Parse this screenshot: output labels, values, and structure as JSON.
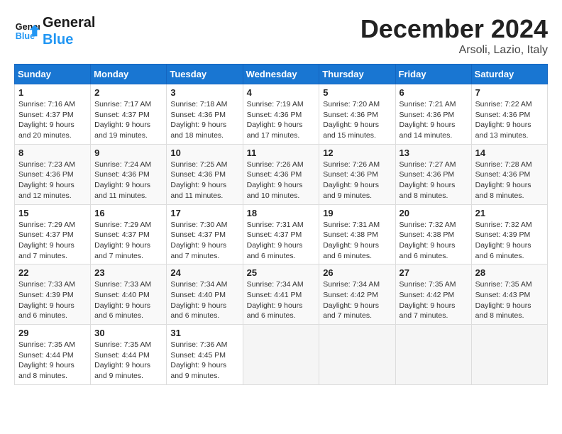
{
  "logo": {
    "line1": "General",
    "line2": "Blue"
  },
  "title": "December 2024",
  "location": "Arsoli, Lazio, Italy",
  "days_of_week": [
    "Sunday",
    "Monday",
    "Tuesday",
    "Wednesday",
    "Thursday",
    "Friday",
    "Saturday"
  ],
  "weeks": [
    [
      {
        "day": "1",
        "info": "Sunrise: 7:16 AM\nSunset: 4:37 PM\nDaylight: 9 hours and 20 minutes."
      },
      {
        "day": "2",
        "info": "Sunrise: 7:17 AM\nSunset: 4:37 PM\nDaylight: 9 hours and 19 minutes."
      },
      {
        "day": "3",
        "info": "Sunrise: 7:18 AM\nSunset: 4:36 PM\nDaylight: 9 hours and 18 minutes."
      },
      {
        "day": "4",
        "info": "Sunrise: 7:19 AM\nSunset: 4:36 PM\nDaylight: 9 hours and 17 minutes."
      },
      {
        "day": "5",
        "info": "Sunrise: 7:20 AM\nSunset: 4:36 PM\nDaylight: 9 hours and 15 minutes."
      },
      {
        "day": "6",
        "info": "Sunrise: 7:21 AM\nSunset: 4:36 PM\nDaylight: 9 hours and 14 minutes."
      },
      {
        "day": "7",
        "info": "Sunrise: 7:22 AM\nSunset: 4:36 PM\nDaylight: 9 hours and 13 minutes."
      }
    ],
    [
      {
        "day": "8",
        "info": "Sunrise: 7:23 AM\nSunset: 4:36 PM\nDaylight: 9 hours and 12 minutes."
      },
      {
        "day": "9",
        "info": "Sunrise: 7:24 AM\nSunset: 4:36 PM\nDaylight: 9 hours and 11 minutes."
      },
      {
        "day": "10",
        "info": "Sunrise: 7:25 AM\nSunset: 4:36 PM\nDaylight: 9 hours and 11 minutes."
      },
      {
        "day": "11",
        "info": "Sunrise: 7:26 AM\nSunset: 4:36 PM\nDaylight: 9 hours and 10 minutes."
      },
      {
        "day": "12",
        "info": "Sunrise: 7:26 AM\nSunset: 4:36 PM\nDaylight: 9 hours and 9 minutes."
      },
      {
        "day": "13",
        "info": "Sunrise: 7:27 AM\nSunset: 4:36 PM\nDaylight: 9 hours and 8 minutes."
      },
      {
        "day": "14",
        "info": "Sunrise: 7:28 AM\nSunset: 4:36 PM\nDaylight: 9 hours and 8 minutes."
      }
    ],
    [
      {
        "day": "15",
        "info": "Sunrise: 7:29 AM\nSunset: 4:37 PM\nDaylight: 9 hours and 7 minutes."
      },
      {
        "day": "16",
        "info": "Sunrise: 7:29 AM\nSunset: 4:37 PM\nDaylight: 9 hours and 7 minutes."
      },
      {
        "day": "17",
        "info": "Sunrise: 7:30 AM\nSunset: 4:37 PM\nDaylight: 9 hours and 7 minutes."
      },
      {
        "day": "18",
        "info": "Sunrise: 7:31 AM\nSunset: 4:37 PM\nDaylight: 9 hours and 6 minutes."
      },
      {
        "day": "19",
        "info": "Sunrise: 7:31 AM\nSunset: 4:38 PM\nDaylight: 9 hours and 6 minutes."
      },
      {
        "day": "20",
        "info": "Sunrise: 7:32 AM\nSunset: 4:38 PM\nDaylight: 9 hours and 6 minutes."
      },
      {
        "day": "21",
        "info": "Sunrise: 7:32 AM\nSunset: 4:39 PM\nDaylight: 9 hours and 6 minutes."
      }
    ],
    [
      {
        "day": "22",
        "info": "Sunrise: 7:33 AM\nSunset: 4:39 PM\nDaylight: 9 hours and 6 minutes."
      },
      {
        "day": "23",
        "info": "Sunrise: 7:33 AM\nSunset: 4:40 PM\nDaylight: 9 hours and 6 minutes."
      },
      {
        "day": "24",
        "info": "Sunrise: 7:34 AM\nSunset: 4:40 PM\nDaylight: 9 hours and 6 minutes."
      },
      {
        "day": "25",
        "info": "Sunrise: 7:34 AM\nSunset: 4:41 PM\nDaylight: 9 hours and 6 minutes."
      },
      {
        "day": "26",
        "info": "Sunrise: 7:34 AM\nSunset: 4:42 PM\nDaylight: 9 hours and 7 minutes."
      },
      {
        "day": "27",
        "info": "Sunrise: 7:35 AM\nSunset: 4:42 PM\nDaylight: 9 hours and 7 minutes."
      },
      {
        "day": "28",
        "info": "Sunrise: 7:35 AM\nSunset: 4:43 PM\nDaylight: 9 hours and 8 minutes."
      }
    ],
    [
      {
        "day": "29",
        "info": "Sunrise: 7:35 AM\nSunset: 4:44 PM\nDaylight: 9 hours and 8 minutes."
      },
      {
        "day": "30",
        "info": "Sunrise: 7:35 AM\nSunset: 4:44 PM\nDaylight: 9 hours and 9 minutes."
      },
      {
        "day": "31",
        "info": "Sunrise: 7:36 AM\nSunset: 4:45 PM\nDaylight: 9 hours and 9 minutes."
      },
      null,
      null,
      null,
      null
    ]
  ]
}
